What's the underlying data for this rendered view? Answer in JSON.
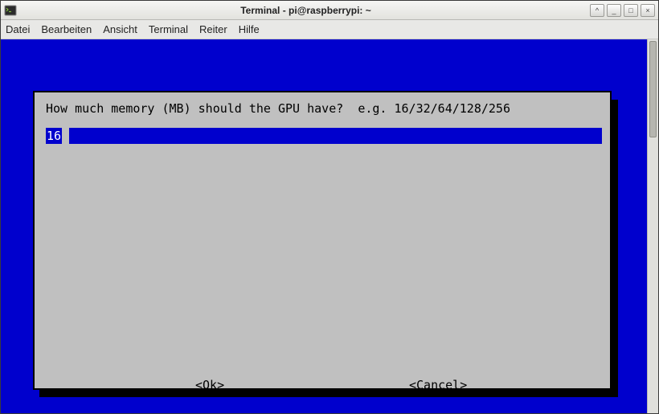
{
  "window": {
    "title": "Terminal - pi@raspberrypi: ~"
  },
  "menubar": {
    "items": [
      "Datei",
      "Bearbeiten",
      "Ansicht",
      "Terminal",
      "Reiter",
      "Hilfe"
    ]
  },
  "dialog": {
    "prompt": "How much memory (MB) should the GPU have?  e.g. 16/32/64/128/256",
    "input_value": "16",
    "ok_label": "<Ok>",
    "cancel_label": "<Cancel>"
  },
  "controls": {
    "up": "^",
    "min": "_",
    "max": "□",
    "close": "×"
  }
}
